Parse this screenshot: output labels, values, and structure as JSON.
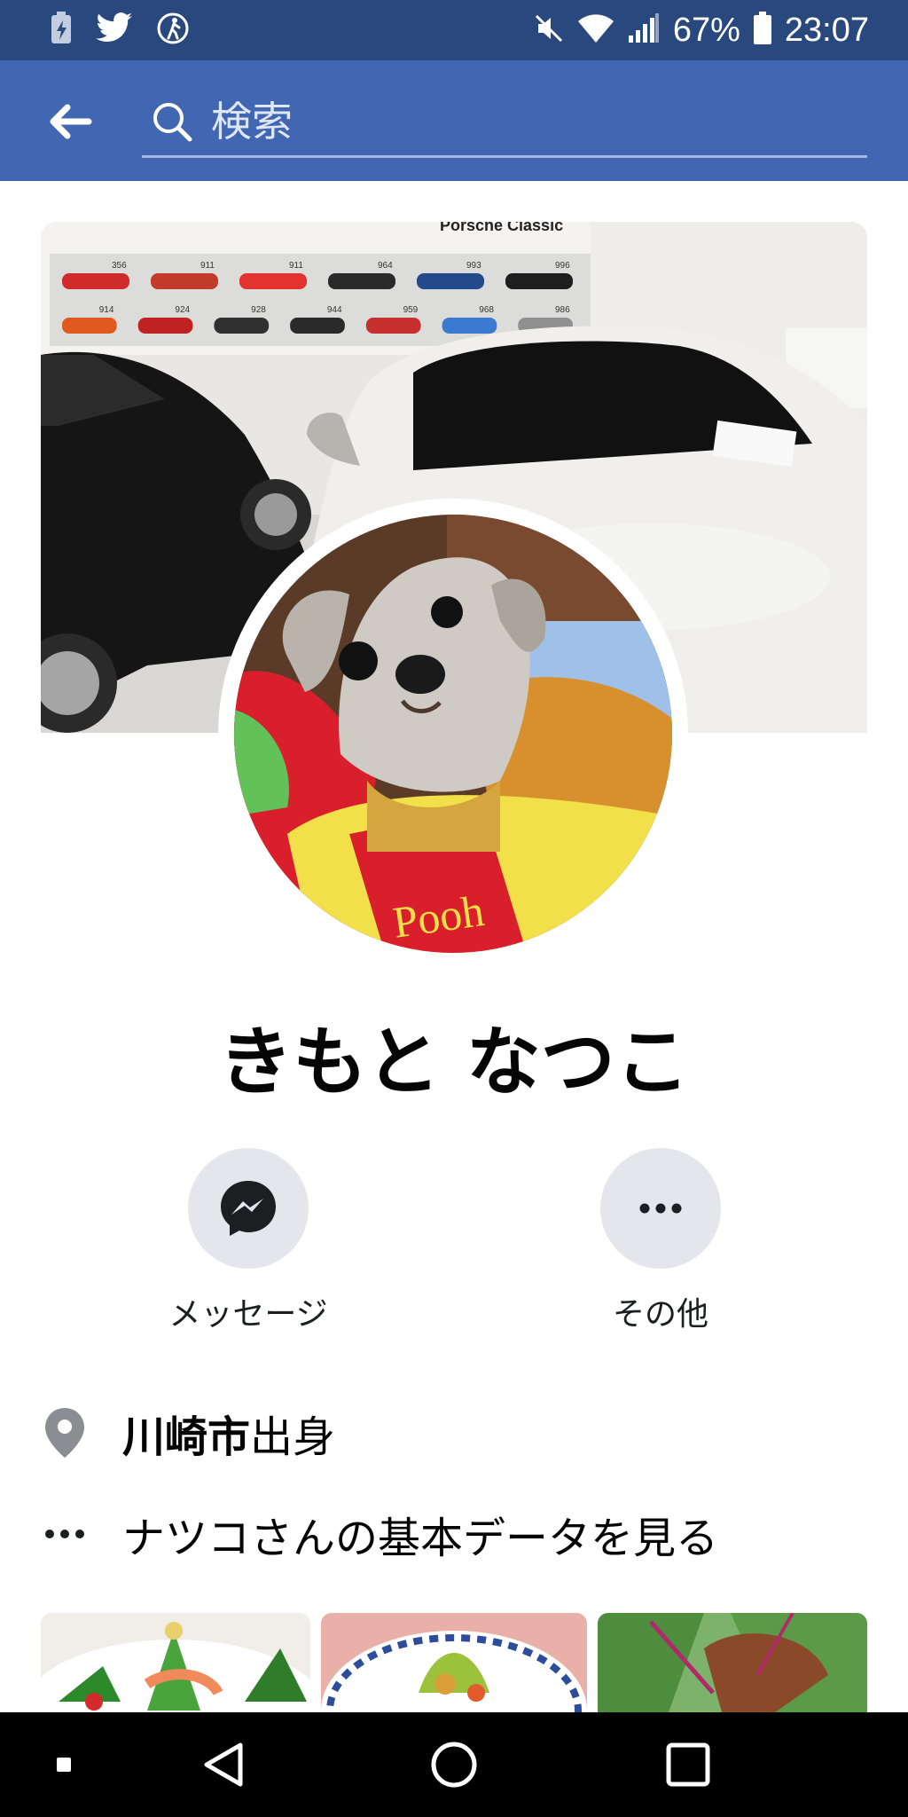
{
  "status_bar": {
    "battery_percent": "67%",
    "time": "23:07",
    "left_icons": [
      "battery-saver-icon",
      "twitter-icon",
      "fitness-icon"
    ],
    "right_icons": [
      "mute-icon",
      "wifi-icon",
      "signal-icon",
      "battery-icon"
    ]
  },
  "header": {
    "search_placeholder": "検索",
    "colors": {
      "status_bar": "#29487d",
      "header": "#4267b2"
    }
  },
  "profile": {
    "name": "きもと なつこ",
    "actions": {
      "message_label": "メッセージ",
      "more_label": "その他"
    },
    "hometown": {
      "place": "川崎市",
      "suffix": "出身"
    },
    "about_link": "ナツコさんの基本データを見る"
  },
  "cover": {
    "sign_text": "Porsche Classic",
    "poster_labels": [
      "356",
      "911",
      "911",
      "964",
      "993",
      "996",
      "914",
      "924",
      "928",
      "944",
      "959",
      "968",
      "986"
    ]
  },
  "avatar": {
    "blanket_text": "Pooh"
  },
  "nav": {
    "items": [
      "back-triangle-icon",
      "home-circle-icon",
      "recents-square-icon"
    ]
  }
}
